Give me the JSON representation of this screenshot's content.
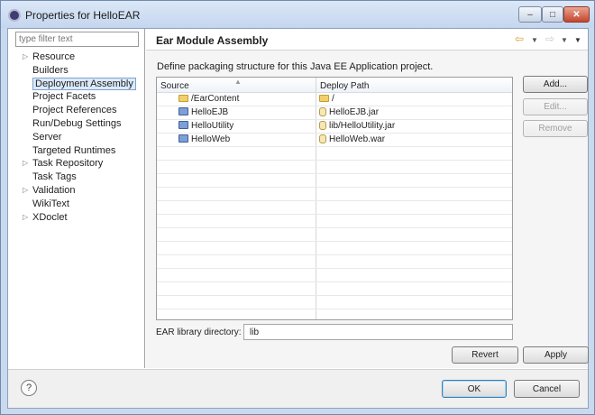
{
  "window": {
    "title": "Properties for HelloEAR",
    "buttons": {
      "minimize": "–",
      "maximize": "□",
      "close": "✕"
    }
  },
  "sidebar": {
    "filter_placeholder": "type filter text",
    "items": [
      {
        "label": "Resource",
        "expandable": true
      },
      {
        "label": "Builders",
        "expandable": false
      },
      {
        "label": "Deployment Assembly",
        "expandable": false,
        "selected": true
      },
      {
        "label": "Project Facets",
        "expandable": false
      },
      {
        "label": "Project References",
        "expandable": false
      },
      {
        "label": "Run/Debug Settings",
        "expandable": false
      },
      {
        "label": "Server",
        "expandable": false
      },
      {
        "label": "Targeted Runtimes",
        "expandable": false
      },
      {
        "label": "Task Repository",
        "expandable": true
      },
      {
        "label": "Task Tags",
        "expandable": false
      },
      {
        "label": "Validation",
        "expandable": true
      },
      {
        "label": "WikiText",
        "expandable": false
      },
      {
        "label": "XDoclet",
        "expandable": true
      }
    ]
  },
  "page": {
    "title": "Ear Module Assembly",
    "description": "Define packaging structure for this Java EE Application project.",
    "table": {
      "columns": [
        "Source",
        "Deploy Path"
      ],
      "rows": [
        {
          "source": "/EarContent",
          "source_icon": "folder-icon",
          "deploy": "/",
          "deploy_icon": "folder-icon"
        },
        {
          "source": "HelloEJB",
          "source_icon": "project-icon",
          "deploy": "HelloEJB.jar",
          "deploy_icon": "jar-icon"
        },
        {
          "source": "HelloUtility",
          "source_icon": "project-icon",
          "deploy": "lib/HelloUtility.jar",
          "deploy_icon": "jar-icon"
        },
        {
          "source": "HelloWeb",
          "source_icon": "project-icon",
          "deploy": "HelloWeb.war",
          "deploy_icon": "jar-icon"
        }
      ]
    },
    "buttons": {
      "add": "Add...",
      "edit": "Edit...",
      "remove": "Remove"
    },
    "library": {
      "label": "EAR library directory:",
      "value": "lib"
    },
    "revert": "Revert",
    "apply": "Apply"
  },
  "footer": {
    "help": "?",
    "ok": "OK",
    "cancel": "Cancel"
  },
  "colors": {
    "selection": "#dbe9fb",
    "titlebar": "#c4d6ee",
    "close_button": "#c5452e"
  }
}
